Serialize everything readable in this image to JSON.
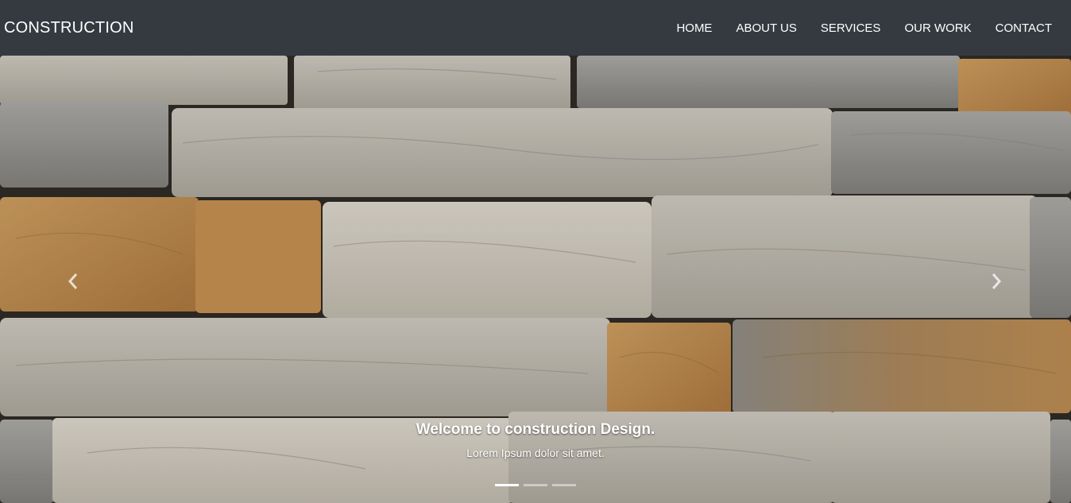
{
  "navbar": {
    "brand": "CONSTRUCTION",
    "links": [
      {
        "label": "HOME"
      },
      {
        "label": "ABOUT US"
      },
      {
        "label": "SERVICES"
      },
      {
        "label": "OUR WORK"
      },
      {
        "label": "CONTACT"
      }
    ],
    "background_color": "#343a40"
  },
  "hero": {
    "background": "stone-wall-photo",
    "caption": {
      "title": "Welcome to construction Design.",
      "text": "Lorem Ipsum dolor sit amet."
    },
    "controls": {
      "prev_icon": "chevron-left-icon",
      "next_icon": "chevron-right-icon"
    },
    "slides_count": 3,
    "active_slide": 1
  }
}
